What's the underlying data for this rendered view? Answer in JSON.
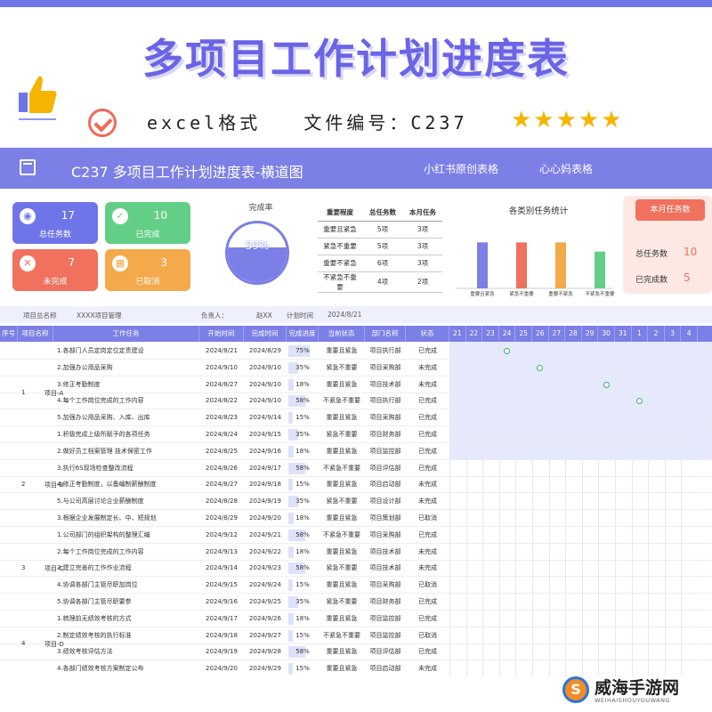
{
  "poster": {
    "title": "多项目工作计划进度表",
    "subline": "excel格式   文件编号：C237",
    "stars": "★★★★★",
    "colors": {
      "accent": "#6f74e8",
      "red": "#f0715d",
      "green": "#63cf86",
      "orange": "#f4a94a",
      "star": "#f4b400"
    }
  },
  "appbar": {
    "title": "C237 多项目工作计划进度表-横道图",
    "tag1": "小红书原创表格",
    "tag2": "心心妈表格"
  },
  "tiles": [
    {
      "icon": "eye-icon",
      "glyph": "◉",
      "value": "17",
      "label": "总任务数"
    },
    {
      "icon": "check-icon",
      "glyph": "✓",
      "value": "10",
      "label": "已完成"
    },
    {
      "icon": "x-icon",
      "glyph": "✕",
      "value": "7",
      "label": "未完成"
    },
    {
      "icon": "grid-icon",
      "glyph": "▦",
      "value": "3",
      "label": "已取消"
    }
  ],
  "gauge": {
    "title": "完成率",
    "value_text": "59%",
    "fraction": 0.59
  },
  "mini_table": {
    "headers": [
      "重要程度",
      "总任务数",
      "本月任务"
    ],
    "rows": [
      [
        "重要且紧急",
        "5项",
        "3项"
      ],
      [
        "紧急不重要",
        "5项",
        "3项"
      ],
      [
        "重要不紧急",
        "6项",
        "3项"
      ],
      [
        "不紧急不重要",
        "4项",
        "2项"
      ]
    ]
  },
  "chart_data": {
    "type": "bar",
    "title": "各类别任务统计",
    "categories": [
      "重要且紧急",
      "紧急不重要",
      "重要不紧急",
      "不紧急不重要"
    ],
    "values": [
      5,
      5,
      5,
      4
    ],
    "colors": [
      "#7b7fe6",
      "#f0715d",
      "#f4a94a",
      "#63cf86"
    ],
    "ylim": [
      0,
      6
    ],
    "grid": false
  },
  "month": {
    "button": "本月任务数",
    "total_label": "总任务数",
    "total_value": "10",
    "done_label": "已完成数",
    "done_value": "5"
  },
  "info": {
    "proj_label": "项目总名称",
    "proj_value": "XXXX项目管理",
    "owner_label": "负责人：",
    "owner_value": "赵XX",
    "time_label": "计划时间",
    "time_value": "2024/8/21"
  },
  "table": {
    "headers": [
      "序号",
      "项目名称",
      "工作任务",
      "开始时间",
      "完成时间",
      "完成进度",
      "当前状态",
      "部门名称",
      "状态"
    ],
    "days": [
      "21",
      "22",
      "23",
      "24",
      "25",
      "26",
      "27",
      "28",
      "29",
      "30",
      "31",
      "1",
      "2",
      "3",
      "4"
    ],
    "projects": [
      {
        "no": "1",
        "name": "项目-A",
        "row_span": [
          0,
          5
        ]
      },
      {
        "no": "2",
        "name": "项目-B",
        "row_span": [
          6,
          10
        ]
      },
      {
        "no": "3",
        "name": "项目-C",
        "row_span": [
          11,
          15
        ]
      },
      {
        "no": "4",
        "name": "项目-D",
        "row_span": [
          16,
          19
        ]
      }
    ],
    "rows": [
      {
        "task": "1.各部门人员定岗定位定责建设",
        "start": "2024/8/21",
        "end": "2024/8/29",
        "prog": "75%",
        "p": 0.75,
        "state": "重要且紧急",
        "dept": "项目执行部",
        "status": "已完成"
      },
      {
        "task": "2.加强办公用品采购",
        "start": "2024/9/10",
        "end": "2024/9/10",
        "prog": "35%",
        "p": 0.35,
        "state": "紧急不重要",
        "dept": "项目采购部",
        "status": "未完成"
      },
      {
        "task": "3.修正考勤制度",
        "start": "2024/8/27",
        "end": "2024/9/10",
        "prog": "18%",
        "p": 0.18,
        "state": "重要且紧急",
        "dept": "项目技术部",
        "status": "未完成"
      },
      {
        "task": "4.每个工作岗位完成的工作内容",
        "start": "2024/8/22",
        "end": "2024/9/10",
        "prog": "58%",
        "p": 0.58,
        "state": "不紧急不重要",
        "dept": "项目执行部",
        "status": "已完成"
      },
      {
        "task": "5.加强办公用品采购、入库、出库",
        "start": "2024/8/23",
        "end": "2024/9/14",
        "prog": "15%",
        "p": 0.15,
        "state": "重要且紧急",
        "dept": "项目采购部",
        "status": "已完成"
      },
      {
        "task": "1.积极完成上级所赋予的各项任务",
        "start": "2024/8/24",
        "end": "2024/9/15",
        "prog": "35%",
        "p": 0.35,
        "state": "紧急不重要",
        "dept": "项目财务部",
        "status": "已完成"
      },
      {
        "task": "2.做好员工档案管理 技术保密工作",
        "start": "2024/8/25",
        "end": "2024/9/16",
        "prog": "18%",
        "p": 0.18,
        "state": "重要且紧急",
        "dept": "项目监控部",
        "status": "已完成"
      },
      {
        "task": "3.执行6S现场检查整改流程",
        "start": "2024/8/26",
        "end": "2024/9/17",
        "prog": "58%",
        "p": 0.58,
        "state": "不紧急不重要",
        "dept": "项目评估部",
        "status": "已完成"
      },
      {
        "task": "4.修正考勤制度，以备编制薪酬制度",
        "start": "2024/8/27",
        "end": "2024/9/18",
        "prog": "15%",
        "p": 0.15,
        "state": "重要且紧急",
        "dept": "项目启动部",
        "status": "未完成"
      },
      {
        "task": "5.与公司高层讨论企业薪酬制度",
        "start": "2024/8/28",
        "end": "2024/9/19",
        "prog": "35%",
        "p": 0.35,
        "state": "紧急不重要",
        "dept": "项目设计部",
        "status": "未完成"
      },
      {
        "task": "3.根据企业发展制定长、中、短规划",
        "start": "2024/8/29",
        "end": "2024/9/20",
        "prog": "18%",
        "p": 0.18,
        "state": "重要且紧急",
        "dept": "项目策划部",
        "status": "已取消"
      },
      {
        "task": "1.公司部门的组织架构的整理汇编",
        "start": "2024/9/12",
        "end": "2024/9/21",
        "prog": "58%",
        "p": 0.58,
        "state": "不紧急不重要",
        "dept": "项目采购部",
        "status": "已完成"
      },
      {
        "task": "2.每个工作岗位完成的工作内容",
        "start": "2024/9/13",
        "end": "2024/9/22",
        "prog": "18%",
        "p": 0.18,
        "state": "重要且紧急",
        "dept": "项目技术部",
        "status": "未完成"
      },
      {
        "task": "3.建立完善的工作作业流程",
        "start": "2024/9/14",
        "end": "2024/9/23",
        "prog": "58%",
        "p": 0.58,
        "state": "紧急不重要",
        "dept": "项目技术部",
        "status": "未完成"
      },
      {
        "task": "4.协调各部门主管尽职加岗位",
        "start": "2024/9/15",
        "end": "2024/9/24",
        "prog": "15%",
        "p": 0.15,
        "state": "重要且紧急",
        "dept": "项目采购部",
        "status": "已取消"
      },
      {
        "task": "5.协调各部门主管尽职要参",
        "start": "2024/9/16",
        "end": "2024/9/25",
        "prog": "35%",
        "p": 0.35,
        "state": "紧急不重要",
        "dept": "项目财务部",
        "status": "已完成"
      },
      {
        "task": "1.梳理前无绩效考核的方式",
        "start": "2024/9/17",
        "end": "2024/9/26",
        "prog": "18%",
        "p": 0.18,
        "state": "重要且紧急",
        "dept": "项目监控部",
        "status": "已完成"
      },
      {
        "task": "2.制定绩效考核的执行标准",
        "start": "2024/9/18",
        "end": "2024/9/27",
        "prog": "15%",
        "p": 0.15,
        "state": "不紧急不重要",
        "dept": "项目监控部",
        "status": "已取消"
      },
      {
        "task": "3.绩效考核评估方法",
        "start": "2024/9/19",
        "end": "2024/9/28",
        "prog": "58%",
        "p": 0.58,
        "state": "重要且紧急",
        "dept": "项目评估部",
        "status": "已完成"
      },
      {
        "task": "4.各部门绩效考核方案制定公布",
        "start": "2024/9/20",
        "end": "2024/9/29",
        "prog": "15%",
        "p": 0.15,
        "state": "重要且紧急",
        "dept": "项目启动部",
        "status": "未完成"
      }
    ],
    "gantt_dots": [
      {
        "row": 0,
        "day": "24"
      },
      {
        "row": 1,
        "day": "26"
      },
      {
        "row": 2,
        "day": "30"
      },
      {
        "row": 3,
        "day": "1"
      }
    ]
  },
  "watermark": {
    "text": "威海手游网",
    "sub": "WEIHAISHOUYOUWANG"
  }
}
